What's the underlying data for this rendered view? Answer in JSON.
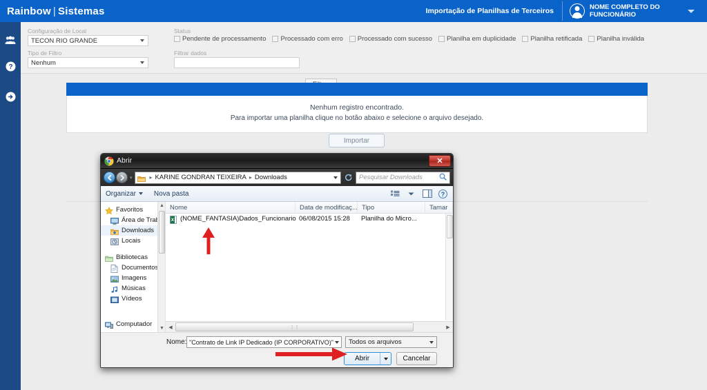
{
  "app": {
    "brand_main": "Rainbow",
    "brand_separator": "|",
    "brand_sub": "Sistemas",
    "page_context": "Importação de Planilhas de Terceiros",
    "user_name": "NOME COMPLETO DO FUNCIONÁRIO",
    "accent_color": "#0a63c9",
    "rail_color": "#1c4a84"
  },
  "rail": {
    "items": [
      {
        "icon": "users-icon"
      },
      {
        "icon": "help-icon"
      },
      {
        "icon": "arrow-right-circle-icon"
      }
    ]
  },
  "filters": {
    "local_label": "Configuração de Local",
    "local_value": "TECON RIO GRANDE",
    "tipo_label": "Tipo de Filtro",
    "tipo_value": "Nenhum",
    "status_label": "Status",
    "status_options": [
      "Pendente de processamento",
      "Processado com erro",
      "Processado com sucesso",
      "Planilha em duplicidade",
      "Planilha retificada",
      "Planilha inválida"
    ],
    "filtrar_dados_label": "Filtrar dados",
    "filtrar_dados_value": "",
    "filtrar_button": "Filtrar"
  },
  "results": {
    "empty_title": "Nenhum registro encontrado.",
    "empty_hint": "Para importar uma planilha clique no botão abaixo e selecione o arquivo desejado.",
    "import_button": "Importar"
  },
  "dialog": {
    "title": "Abrir",
    "close_label": "✕",
    "breadcrumb": [
      "KARINE GONDRAN TEIXEIRA",
      "Downloads"
    ],
    "search_placeholder": "Pesquisar Downloads",
    "toolbar": {
      "organizar": "Organizar",
      "nova_pasta": "Nova pasta"
    },
    "places": [
      {
        "label": "Favoritos",
        "icon": "star-icon",
        "group": true
      },
      {
        "label": "Área de Trabalh",
        "icon": "desktop-icon",
        "group": false
      },
      {
        "label": "Downloads",
        "icon": "downloads-icon",
        "group": false,
        "selected": true
      },
      {
        "label": "Locais",
        "icon": "recent-places-icon",
        "group": false
      },
      {
        "label": "Bibliotecas",
        "icon": "libraries-icon",
        "group": true
      },
      {
        "label": "Documentos",
        "icon": "documents-icon",
        "group": false
      },
      {
        "label": "Imagens",
        "icon": "pictures-icon",
        "group": false
      },
      {
        "label": "Músicas",
        "icon": "music-icon",
        "group": false
      },
      {
        "label": "Vídeos",
        "icon": "videos-icon",
        "group": false
      },
      {
        "label": "Computador",
        "icon": "computer-icon",
        "group": true
      }
    ],
    "columns": [
      "Nome",
      "Data de modificaç...",
      "Tipo",
      "Tamar"
    ],
    "files": [
      {
        "name": "(NOME_FANTASIA)Dados_Funcionario",
        "date": "06/08/2015 15:28",
        "type": "Planilha do Micro...",
        "size": ""
      }
    ],
    "footer": {
      "nome_label": "Nome:",
      "nome_value": "\"Contrato de Link  IP Dedicado (IP CORPORATIVO)\" \"IP",
      "filetype_value": "Todos os arquivos",
      "abrir_button": "Abrir",
      "cancelar_button": "Cancelar"
    }
  },
  "annotations": {
    "color": "#e02020",
    "arrows": [
      {
        "name": "arrow-pointing-to-file",
        "direction": "up"
      },
      {
        "name": "arrow-pointing-to-abrir",
        "direction": "right"
      }
    ]
  }
}
